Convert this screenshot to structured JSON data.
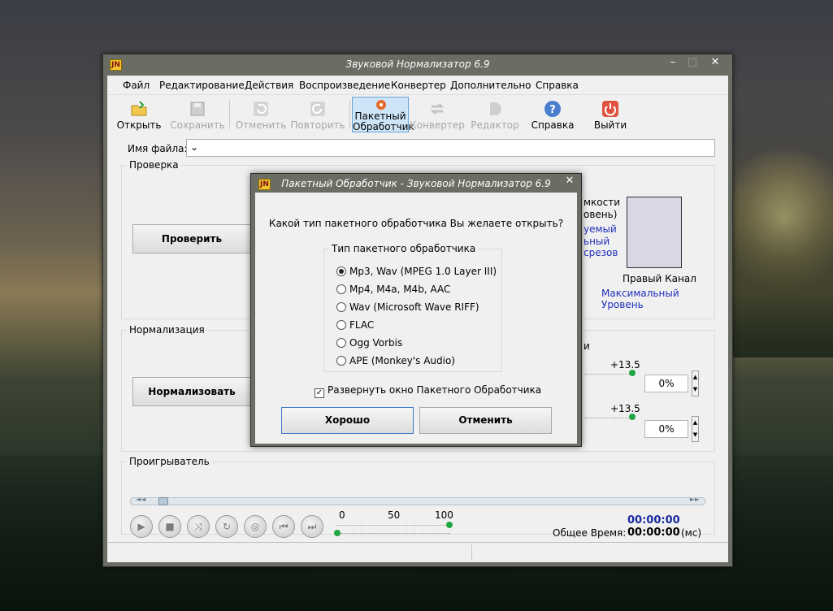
{
  "window": {
    "title": "Звуковой Нормализатор 6.9",
    "icon_text": "JN"
  },
  "menu": [
    "Файл",
    "Редактирование",
    "Действия",
    "Воспроизведение",
    "Конвертер",
    "Дополнительно",
    "Справка"
  ],
  "toolbar": {
    "open": "Открыть",
    "save": "Сохранить",
    "undo": "Отменить",
    "redo": "Повторить",
    "batch_line1": "Пакетный",
    "batch_line2": "Обработчик",
    "converter": "Конвертер",
    "editor": "Редактор",
    "help": "Справка",
    "exit": "Выйти"
  },
  "file": {
    "label": "Имя файла:",
    "value": ""
  },
  "check_group": {
    "title": "Проверка",
    "button": "Проверить",
    "partial_line1": "мкости",
    "partial_line2": "овень)",
    "partial_blue1": "уемый",
    "partial_blue2": "ьный",
    "partial_blue3": "срезов",
    "right_channel": "Правый Канал",
    "max_level": "Максимальный Уровень"
  },
  "norm_group": {
    "title": "Нормализация",
    "button": "Нормализовать",
    "partial": "и",
    "value1": "+13.5",
    "value2": "+13.5",
    "pct1": "0%",
    "pct2": "0%"
  },
  "player": {
    "title": "Проигрыватель",
    "scale": [
      "0",
      "50",
      "100"
    ],
    "time_current": "00:00:00",
    "total_label": "Общее Время:",
    "total_value": "00:00:00",
    "unit": "(мс)"
  },
  "dialog": {
    "title": "Пакетный Обработчик - Звуковой Нормализатор 6.9",
    "question": "Какой тип пакетного обработчика Вы желаете открыть?",
    "group_title": "Тип пакетного обработчика",
    "options": [
      "Mp3, Wav (MPEG 1.0 Layer III)",
      "Mp4, M4a, M4b, AAC",
      "Wav (Microsoft Wave RIFF)",
      "FLAC",
      "Ogg Vorbis",
      "APE (Monkey's Audio)"
    ],
    "selected_index": 0,
    "expand_label": "Развернуть окно Пакетного Обработчика",
    "expand_checked": true,
    "ok": "Хорошо",
    "cancel": "Отменить"
  },
  "colors": {
    "accent_blue": "#1e2fbd",
    "time_blue": "#1a2aa0",
    "green_knob": "#22a544"
  }
}
